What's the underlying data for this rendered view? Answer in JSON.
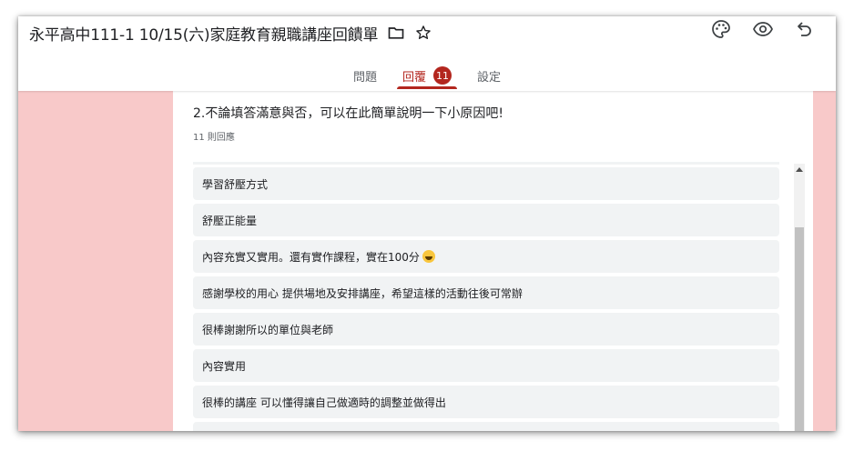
{
  "form": {
    "title": "永平高中111-1  10/15(六)家庭教育親職講座回饋單",
    "title_icons": [
      "folder-icon",
      "star-icon"
    ]
  },
  "toolbar": {
    "icons": [
      "palette-icon",
      "eye-preview-icon",
      "undo-icon"
    ]
  },
  "tabs": [
    {
      "label": "問題",
      "active": false
    },
    {
      "label": "回覆",
      "active": true,
      "badge": "11"
    },
    {
      "label": "設定",
      "active": false
    }
  ],
  "question": {
    "title": "2.不論填答滿意與否，可以在此簡單說明一下小原因吧!",
    "response_count": "11 則回應",
    "responses": [
      "學習舒壓方式",
      "舒壓正能量",
      "內容充實又實用。還有實作課程，實在100分",
      "感謝學校的用心 提供場地及安排講座，希望這樣的活動往後可常辦",
      "很棒謝謝所以的單位與老師",
      "內容實用",
      "很棒的講座 可以懂得讓自己做適時的調整並做得出"
    ]
  },
  "colors": {
    "accent": "#b3261e",
    "background": "#f8c9c9"
  }
}
